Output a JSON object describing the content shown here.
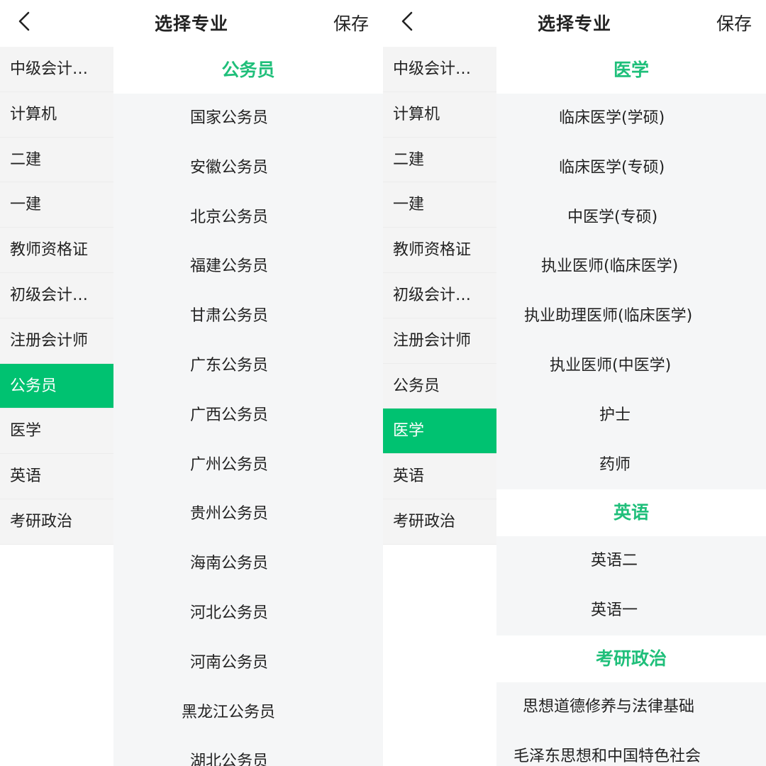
{
  "left": {
    "nav": {
      "title": "选择专业",
      "save_label": "保存"
    },
    "sidebar": [
      {
        "label": "中级会计…",
        "active": false
      },
      {
        "label": "计算机",
        "active": false
      },
      {
        "label": "二建",
        "active": false
      },
      {
        "label": "一建",
        "active": false
      },
      {
        "label": "教师资格证",
        "active": false
      },
      {
        "label": "初级会计…",
        "active": false
      },
      {
        "label": "注册会计师",
        "active": false
      },
      {
        "label": "公务员",
        "active": true
      },
      {
        "label": "医学",
        "active": false
      },
      {
        "label": "英语",
        "active": false
      },
      {
        "label": "考研政治",
        "active": false
      }
    ],
    "sections": [
      {
        "title": "公务员",
        "items": [
          "国家公务员",
          "安徽公务员",
          "北京公务员",
          "福建公务员",
          "甘肃公务员",
          "广东公务员",
          "广西公务员",
          "广州公务员",
          "贵州公务员",
          "海南公务员",
          "河北公务员",
          "河南公务员",
          "黑龙江公务员",
          "湖北公务员"
        ]
      }
    ]
  },
  "right": {
    "nav": {
      "title": "选择专业",
      "save_label": "保存"
    },
    "sidebar": [
      {
        "label": "中级会计…",
        "active": false
      },
      {
        "label": "计算机",
        "active": false
      },
      {
        "label": "二建",
        "active": false
      },
      {
        "label": "一建",
        "active": false
      },
      {
        "label": "教师资格证",
        "active": false
      },
      {
        "label": "初级会计…",
        "active": false
      },
      {
        "label": "注册会计师",
        "active": false
      },
      {
        "label": "公务员",
        "active": false
      },
      {
        "label": "医学",
        "active": true
      },
      {
        "label": "英语",
        "active": false
      },
      {
        "label": "考研政治",
        "active": false
      }
    ],
    "sections": [
      {
        "title": "医学",
        "items": [
          "临床医学(学硕)",
          "临床医学(专硕)",
          "中医学(专硕)",
          "执业医师(临床医学)",
          "执业助理医师(临床医学)",
          "执业医师(中医学)",
          "护士",
          "药师"
        ]
      },
      {
        "title": "英语",
        "items": [
          "英语二",
          "英语一"
        ]
      },
      {
        "title": "考研政治",
        "items": [
          "思想道德修养与法律基础",
          "毛泽东思想和中国特色社会"
        ]
      }
    ]
  },
  "colors": {
    "accent": "#00c271",
    "section_title": "#1fbf7a",
    "sidebar_bg": "#f4f4f4",
    "list_bg": "#f5f6f7"
  },
  "icons": {
    "back": "chevron-left-icon"
  }
}
